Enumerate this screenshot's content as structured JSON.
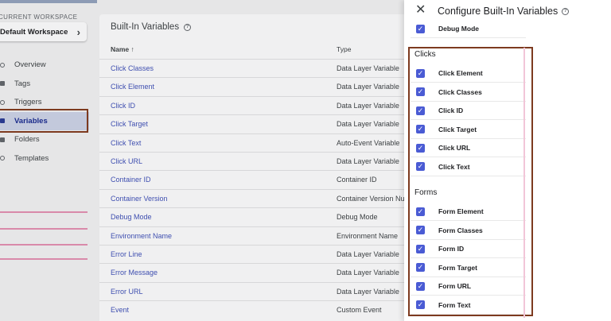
{
  "workspace": {
    "label": "CURRENT WORKSPACE",
    "name": "Default Workspace"
  },
  "nav": [
    {
      "label": "Overview",
      "active": false
    },
    {
      "label": "Tags",
      "active": false
    },
    {
      "label": "Triggers",
      "active": false
    },
    {
      "label": "Variables",
      "active": true
    },
    {
      "label": "Folders",
      "active": false
    },
    {
      "label": "Templates",
      "active": false
    }
  ],
  "main": {
    "title": "Built-In Variables",
    "columns": {
      "name": "Name ↑",
      "type": "Type"
    },
    "rows": [
      {
        "name": "Click Classes",
        "type": "Data Layer Variable"
      },
      {
        "name": "Click Element",
        "type": "Data Layer Variable"
      },
      {
        "name": "Click ID",
        "type": "Data Layer Variable"
      },
      {
        "name": "Click Target",
        "type": "Data Layer Variable"
      },
      {
        "name": "Click Text",
        "type": "Auto-Event Variable"
      },
      {
        "name": "Click URL",
        "type": "Data Layer Variable"
      },
      {
        "name": "Container ID",
        "type": "Container ID"
      },
      {
        "name": "Container Version",
        "type": "Container Version Num"
      },
      {
        "name": "Debug Mode",
        "type": "Debug Mode"
      },
      {
        "name": "Environment Name",
        "type": "Environment Name"
      },
      {
        "name": "Error Line",
        "type": "Data Layer Variable"
      },
      {
        "name": "Error Message",
        "type": "Data Layer Variable"
      },
      {
        "name": "Error URL",
        "type": "Data Layer Variable"
      },
      {
        "name": "Event",
        "type": "Custom Event"
      }
    ]
  },
  "panel": {
    "title": "Configure Built-In Variables",
    "close_icon": "close-icon",
    "accent": "#4a5bd4",
    "top_item": {
      "label": "Debug Mode",
      "checked": true
    },
    "sections": [
      {
        "title": "Clicks",
        "items": [
          "Click Element",
          "Click Classes",
          "Click ID",
          "Click Target",
          "Click URL",
          "Click Text"
        ]
      },
      {
        "title": "Forms",
        "items": [
          "Form Element",
          "Form Classes",
          "Form ID",
          "Form Target",
          "Form URL",
          "Form Text"
        ]
      }
    ]
  }
}
